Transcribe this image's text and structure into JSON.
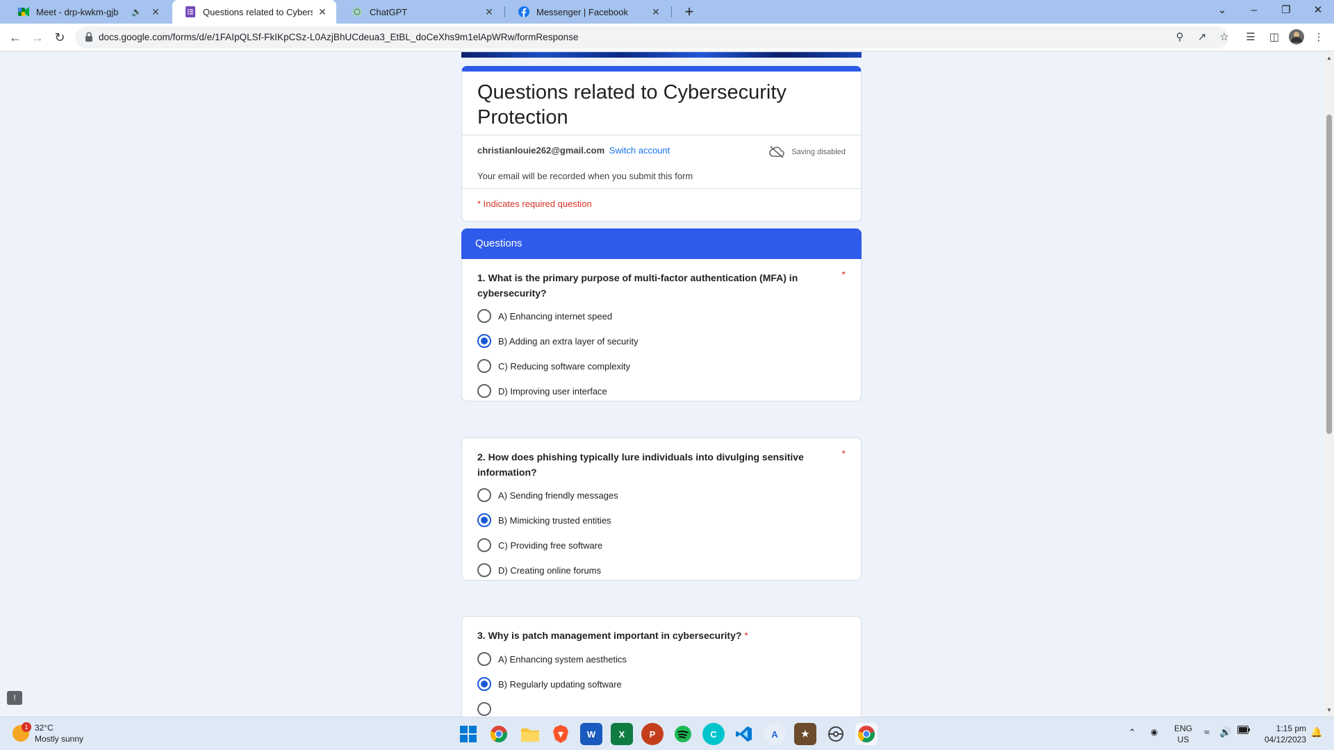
{
  "browser": {
    "tabs": [
      {
        "title": "Meet - drp-kwkm-gjb",
        "icon": "google-meet-icon",
        "muted": true
      },
      {
        "title": "Questions related to Cybersecur",
        "icon": "google-forms-icon",
        "active": true
      },
      {
        "title": "ChatGPT",
        "icon": "chatgpt-icon"
      },
      {
        "title": "Messenger | Facebook",
        "icon": "facebook-icon"
      }
    ],
    "url": "docs.google.com/forms/d/e/1FAIpQLSf-FkIKpCSz-L0AzjBhUCdeua3_EtBL_doCeXhs9m1elApWRw/formResponse"
  },
  "form": {
    "title": "Questions related to Cybersecurity Protection",
    "email": "christianlouie262@gmail.com",
    "switch_account": "Switch account",
    "saving_status": "Saving disabled",
    "record_note": "Your email will be recorded when you submit this form",
    "required_note": "* Indicates required question",
    "section_title": "Questions",
    "required_star": "*"
  },
  "questions": [
    {
      "text": "1. What is the primary purpose of multi-factor authentication (MFA) in cybersecurity?",
      "options": [
        "A) Enhancing internet speed",
        "B) Adding an extra layer of security",
        "C) Reducing software complexity",
        "D) Improving user interface"
      ],
      "selected": 1
    },
    {
      "text": "2.  How does phishing typically lure individuals into divulging sensitive information?",
      "options": [
        "A) Sending friendly messages",
        "B) Mimicking trusted entities",
        "C) Providing free software",
        "D) Creating online forums"
      ],
      "selected": 1
    },
    {
      "text": "3.  Why is patch management important in cybersecurity?",
      "options": [
        "A) Enhancing system aesthetics",
        "B) Regularly updating software"
      ],
      "selected": 1
    }
  ],
  "taskbar": {
    "weather_temp": "32°C",
    "weather_desc": "Mostly sunny",
    "weather_badge": "1",
    "lang_top": "ENG",
    "lang_bottom": "US",
    "time": "1:15 pm",
    "date": "04/12/2023"
  },
  "colors": {
    "accent": "#2f5bea",
    "radio_selected": "#1a58d6",
    "required": "#d93025",
    "page_bg": "#edf2fb",
    "tabbar_bg": "#a5c3ee"
  }
}
